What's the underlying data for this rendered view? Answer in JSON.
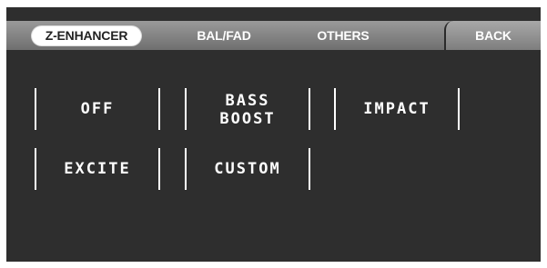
{
  "tabs": {
    "z_enhancer": "Z-ENHANCER",
    "bal_fad": "BAL/FAD",
    "others": "OTHERS",
    "back": "BACK"
  },
  "buttons": {
    "off": "OFF",
    "bass_boost": "BASS\nBOOST",
    "impact": "IMPACT",
    "excite": "EXCITE",
    "custom": "CUSTOM"
  },
  "colors": {
    "screen_background": "#2e2e2e",
    "tab_bar": "#8a8a8a",
    "active_tab": "#ffffff",
    "button_text": "#ffffff"
  }
}
